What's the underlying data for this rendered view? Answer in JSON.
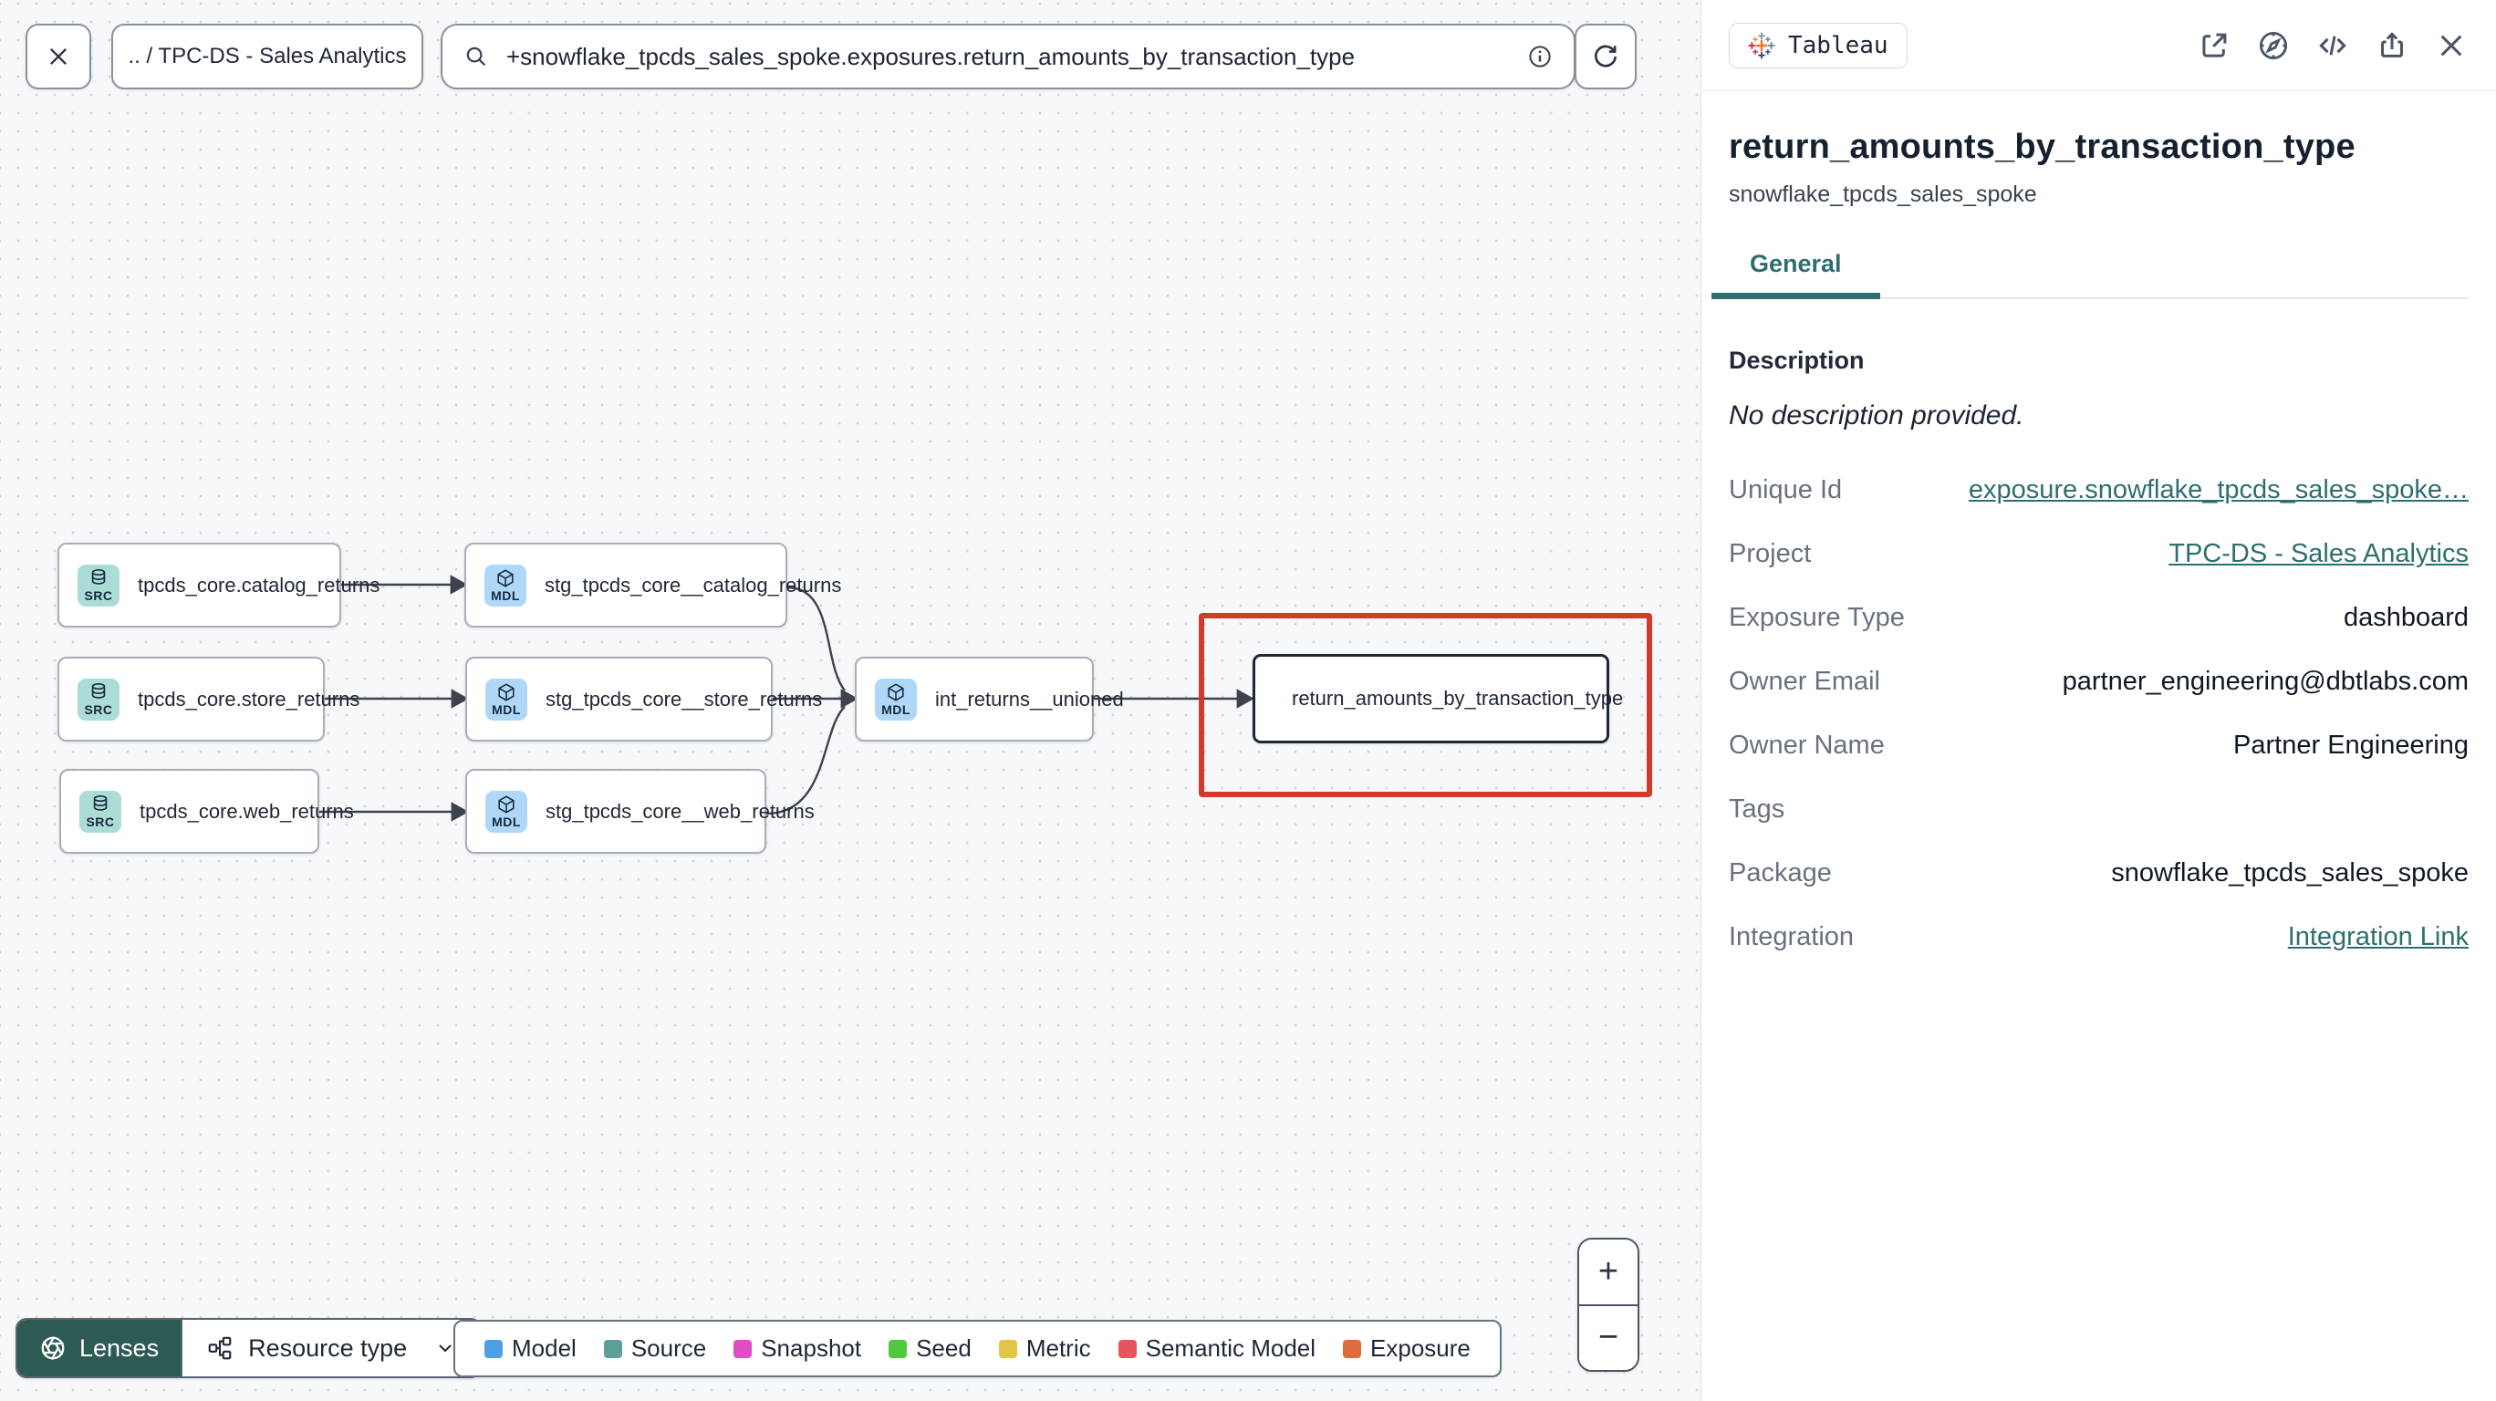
{
  "colors": {
    "accent_teal": "#2F6E6E",
    "highlight_red": "#D23B29",
    "lenses_green": "#2D5B53",
    "source_badge_bg": "#ABDCD5",
    "model_badge_bg": "#AFD8F8",
    "edge": "#3C434E"
  },
  "topbar": {
    "breadcrumb": ".. / TPC-DS - Sales Analytics",
    "search_value": "+snowflake_tpcds_sales_spoke.exposures.return_amounts_by_transaction_type"
  },
  "graph": {
    "nodes": [
      {
        "type": "source",
        "badge": "SRC",
        "label": "tpcds_core.catalog_returns"
      },
      {
        "type": "source",
        "badge": "SRC",
        "label": "tpcds_core.store_returns"
      },
      {
        "type": "source",
        "badge": "SRC",
        "label": "tpcds_core.web_returns"
      },
      {
        "type": "model",
        "badge": "MDL",
        "label": "stg_tpcds_core__catalog_returns"
      },
      {
        "type": "model",
        "badge": "MDL",
        "label": "stg_tpcds_core__store_returns"
      },
      {
        "type": "model",
        "badge": "MDL",
        "label": "stg_tpcds_core__web_returns"
      },
      {
        "type": "model",
        "badge": "MDL",
        "label": "int_returns__unioned"
      },
      {
        "type": "exposure",
        "label": "return_amounts_by_transaction_type",
        "selected": true
      }
    ]
  },
  "toolbar": {
    "lenses_label": "Lenses",
    "resource_type_label": "Resource type"
  },
  "legend": {
    "items": [
      {
        "label": "Model",
        "color": "#4C9FE0"
      },
      {
        "label": "Source",
        "color": "#5D9E98"
      },
      {
        "label": "Snapshot",
        "color": "#DE4FC6"
      },
      {
        "label": "Seed",
        "color": "#52C83E"
      },
      {
        "label": "Metric",
        "color": "#E5C445"
      },
      {
        "label": "Semantic Model",
        "color": "#E4555F"
      },
      {
        "label": "Exposure",
        "color": "#DD6E3B"
      }
    ]
  },
  "zoom_controls": {
    "zoom_in": "+",
    "zoom_out": "−"
  },
  "panel": {
    "integration_chip": "Tableau",
    "title": "return_amounts_by_transaction_type",
    "subtitle": "snowflake_tpcds_sales_spoke",
    "active_tab": "General",
    "description_heading": "Description",
    "description_empty": "No description provided.",
    "fields": [
      {
        "label": "Unique Id",
        "value": "exposure.snowflake_tpcds_sales_spoke…",
        "link": true
      },
      {
        "label": "Project",
        "value": "TPC-DS - Sales Analytics",
        "link": true
      },
      {
        "label": "Exposure Type",
        "value": "dashboard"
      },
      {
        "label": "Owner Email",
        "value": "partner_engineering@dbtlabs.com"
      },
      {
        "label": "Owner Name",
        "value": "Partner Engineering"
      },
      {
        "label": "Tags",
        "value": ""
      },
      {
        "label": "Package",
        "value": "snowflake_tpcds_sales_spoke"
      },
      {
        "label": "Integration",
        "value": "Integration Link",
        "link": true
      }
    ]
  }
}
